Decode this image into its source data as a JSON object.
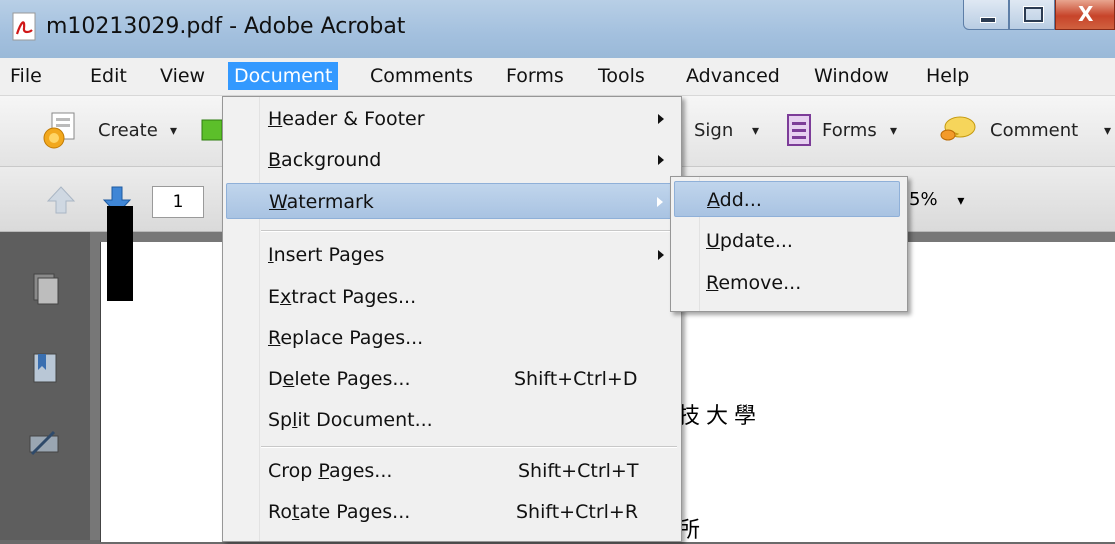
{
  "window": {
    "title": "m10213029.pdf - Adobe Acrobat",
    "close_glyph": "X"
  },
  "menubar": {
    "items": [
      "File",
      "Edit",
      "View",
      "Document",
      "Comments",
      "Forms",
      "Tools",
      "Advanced",
      "Window",
      "Help"
    ],
    "active": "Document"
  },
  "toolbar": {
    "create": "Create",
    "sign": "Sign",
    "forms": "Forms",
    "comment": "Comment",
    "dropdown_glyph": "▾"
  },
  "navigation": {
    "page_number": "1",
    "zoom_partial": ")5%"
  },
  "document_menu": {
    "items": [
      {
        "label": "Header & Footer",
        "submenu": true
      },
      {
        "label": "Background",
        "submenu": true
      },
      {
        "label": "Watermark",
        "submenu": true,
        "highlighted": true
      },
      {
        "label": "Insert Pages",
        "submenu": true
      },
      {
        "label": "Extract Pages...",
        "submenu": false
      },
      {
        "label": "Replace Pages...",
        "submenu": false
      },
      {
        "label": "Delete Pages...",
        "shortcut": "Shift+Ctrl+D"
      },
      {
        "label": "Split Document...",
        "submenu": false
      },
      {
        "label": "Crop Pages...",
        "shortcut": "Shift+Ctrl+T"
      },
      {
        "label": "Rotate Pages...",
        "shortcut": "Shift+Ctrl+R"
      }
    ]
  },
  "watermark_submenu": {
    "items": [
      {
        "label": "Add...",
        "highlighted": true
      },
      {
        "label": "Update..."
      },
      {
        "label": "Remove..."
      }
    ]
  },
  "page_content": {
    "text_1": "技大學",
    "text_2": "所"
  },
  "colors": {
    "menu_active": "#3399ff",
    "menu_highlight": "#b8cfe8",
    "titlebar": "#a3c0de"
  }
}
